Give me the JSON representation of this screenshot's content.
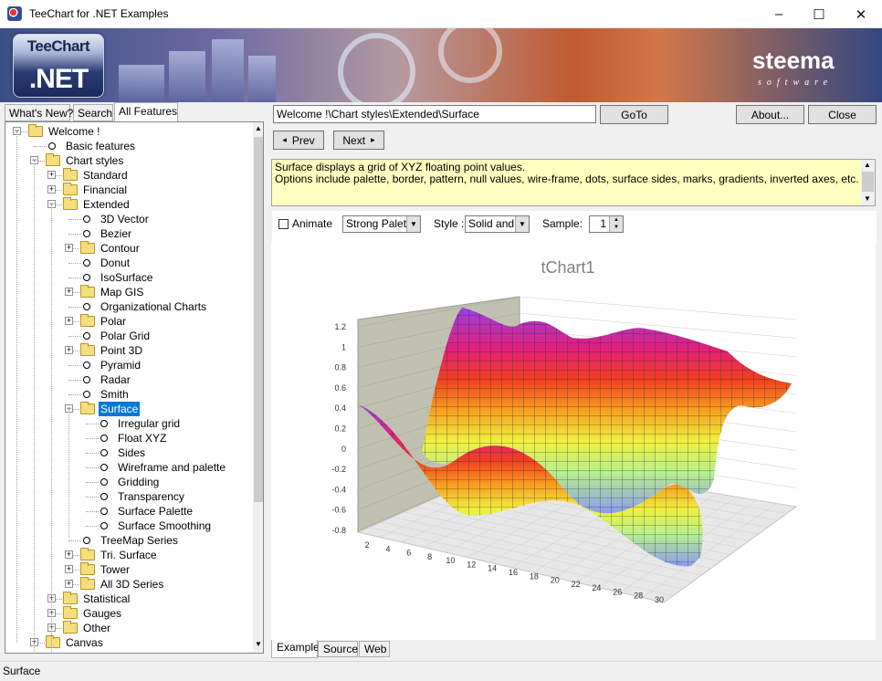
{
  "window": {
    "title": "TeeChart for .NET Examples",
    "minimize": "–",
    "maximize": "☐",
    "close": "✕"
  },
  "banner": {
    "logo_top": "TeeChart",
    "logo_bottom": ".NET",
    "brand": "steema",
    "brand_sub": "software"
  },
  "left_tabs": [
    "What's New?",
    "Search",
    "All Features"
  ],
  "tree": [
    {
      "label": "Welcome !",
      "level": 0,
      "type": "folder",
      "exp": "-"
    },
    {
      "label": "Basic features",
      "level": 1,
      "type": "leaf"
    },
    {
      "label": "Chart styles",
      "level": 1,
      "type": "folder",
      "exp": "-"
    },
    {
      "label": "Standard",
      "level": 2,
      "type": "folder",
      "exp": "+"
    },
    {
      "label": "Financial",
      "level": 2,
      "type": "folder",
      "exp": "+"
    },
    {
      "label": "Extended",
      "level": 2,
      "type": "folder",
      "exp": "-"
    },
    {
      "label": "3D Vector",
      "level": 3,
      "type": "leaf"
    },
    {
      "label": "Bezier",
      "level": 3,
      "type": "leaf"
    },
    {
      "label": "Contour",
      "level": 3,
      "type": "folder",
      "exp": "+"
    },
    {
      "label": "Donut",
      "level": 3,
      "type": "leaf"
    },
    {
      "label": "IsoSurface",
      "level": 3,
      "type": "leaf"
    },
    {
      "label": "Map GIS",
      "level": 3,
      "type": "folder",
      "exp": "+"
    },
    {
      "label": "Organizational Charts",
      "level": 3,
      "type": "leaf"
    },
    {
      "label": "Polar",
      "level": 3,
      "type": "folder",
      "exp": "+"
    },
    {
      "label": "Polar Grid",
      "level": 3,
      "type": "leaf"
    },
    {
      "label": "Point 3D",
      "level": 3,
      "type": "folder",
      "exp": "+"
    },
    {
      "label": "Pyramid",
      "level": 3,
      "type": "leaf"
    },
    {
      "label": "Radar",
      "level": 3,
      "type": "leaf"
    },
    {
      "label": "Smith",
      "level": 3,
      "type": "leaf"
    },
    {
      "label": "Surface",
      "level": 3,
      "type": "folder",
      "exp": "-",
      "selected": true
    },
    {
      "label": "Irregular grid",
      "level": 4,
      "type": "leaf"
    },
    {
      "label": "Float XYZ",
      "level": 4,
      "type": "leaf"
    },
    {
      "label": "Sides",
      "level": 4,
      "type": "leaf"
    },
    {
      "label": "Wireframe and palette",
      "level": 4,
      "type": "leaf"
    },
    {
      "label": "Gridding",
      "level": 4,
      "type": "leaf"
    },
    {
      "label": "Transparency",
      "level": 4,
      "type": "leaf"
    },
    {
      "label": "Surface Palette",
      "level": 4,
      "type": "leaf"
    },
    {
      "label": "Surface Smoothing",
      "level": 4,
      "type": "leaf"
    },
    {
      "label": "TreeMap Series",
      "level": 3,
      "type": "leaf"
    },
    {
      "label": "Tri. Surface",
      "level": 3,
      "type": "folder",
      "exp": "+"
    },
    {
      "label": "Tower",
      "level": 3,
      "type": "folder",
      "exp": "+"
    },
    {
      "label": "All 3D Series",
      "level": 3,
      "type": "folder",
      "exp": "+"
    },
    {
      "label": "Statistical",
      "level": 2,
      "type": "folder",
      "exp": "+"
    },
    {
      "label": "Gauges",
      "level": 2,
      "type": "folder",
      "exp": "+"
    },
    {
      "label": "Other",
      "level": 2,
      "type": "folder",
      "exp": "+"
    },
    {
      "label": "Canvas",
      "level": 1,
      "type": "folder",
      "exp": "+"
    }
  ],
  "nav": {
    "path": "Welcome !\\Chart styles\\Extended\\Surface",
    "goto": "GoTo",
    "about": "About...",
    "close": "Close",
    "prev": "Prev",
    "next": "Next",
    "prev_icon": "◂",
    "next_icon": "▸"
  },
  "description": {
    "line1": "Surface displays a grid of XYZ floating point values.",
    "line2": "Options include palette, border, pattern, null values, wire-frame, dots, surface sides, marks, gradients, inverted axes, etc."
  },
  "options": {
    "animate": "Animate",
    "palette_value": "Strong Palette",
    "style_label": "Style :",
    "style_value": "Solid and Grid",
    "sample_label": "Sample:",
    "sample_value": "1"
  },
  "chart": {
    "title": "tChart1",
    "y_ticks": [
      "1.2",
      "1",
      "0.8",
      "0.6",
      "0.4",
      "0.2",
      "0",
      "-0.2",
      "-0.4",
      "-0.6",
      "-0.8"
    ],
    "x_ticks": [
      "2",
      "4",
      "6",
      "8",
      "10",
      "12",
      "14",
      "16",
      "18",
      "20",
      "22",
      "24",
      "26",
      "28",
      "30"
    ]
  },
  "chart_data": {
    "type": "surface",
    "title": "tChart1",
    "ylim": [
      -0.8,
      1.2
    ],
    "xlim": [
      2,
      30
    ],
    "zlim": [
      1,
      30
    ]
  },
  "bottom_tabs": [
    "Example",
    "Source",
    "Web"
  ],
  "status": "Surface"
}
